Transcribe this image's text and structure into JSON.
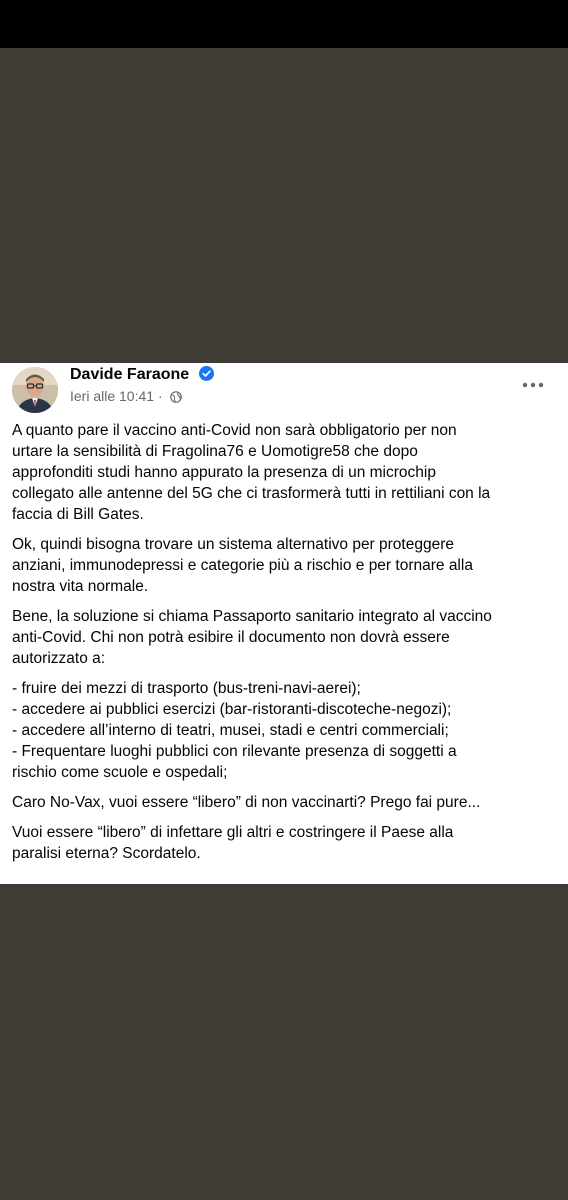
{
  "post": {
    "author": "Davide Faraone",
    "timestamp": "Ieri alle 10:41",
    "separator": "·",
    "icons": {
      "verified": "verified-badge-icon",
      "audience": "globe-icon",
      "more": "more-options-icon"
    },
    "colors": {
      "background": "#3f3c35",
      "card": "#ffffff",
      "verified": "#1877f2",
      "meta": "#65676b"
    },
    "paragraphs": [
      "A quanto pare il vaccino anti-Covid non sarà obbligatorio per non\nurtare la sensibilità di Fragolina76 e Uomotigre58 che dopo\napprofonditi studi hanno appurato la presenza di un microchip\ncollegato alle antenne del 5G che ci trasformerà tutti in rettiliani con la\nfaccia di Bill Gates.",
      "Ok, quindi bisogna trovare un sistema alternativo per proteggere\nanziani, immunodepressi e categorie più a rischio e per tornare alla\nnostra vita normale.",
      "Bene, la soluzione si chiama Passaporto sanitario integrato al vaccino\nanti-Covid. Chi non potrà esibire il documento non dovrà essere\nautorizzato a:"
    ],
    "bullets": [
      "- fruire dei mezzi di trasporto (bus-treni-navi-aerei);",
      "- accedere ai pubblici esercizi (bar-ristoranti-discoteche-negozi);",
      "- accedere all’interno di teatri, musei, stadi e centri commerciali;",
      "- Frequentare luoghi pubblici con rilevante presenza di soggetti a\nrischio come scuole e ospedali;"
    ],
    "closing": [
      "Caro No-Vax, vuoi essere “libero” di non vaccinarti? Prego fai pure...",
      "Vuoi essere “libero” di infettare gli altri e costringere il Paese alla\nparalisi eterna? Scordatelo."
    ]
  }
}
